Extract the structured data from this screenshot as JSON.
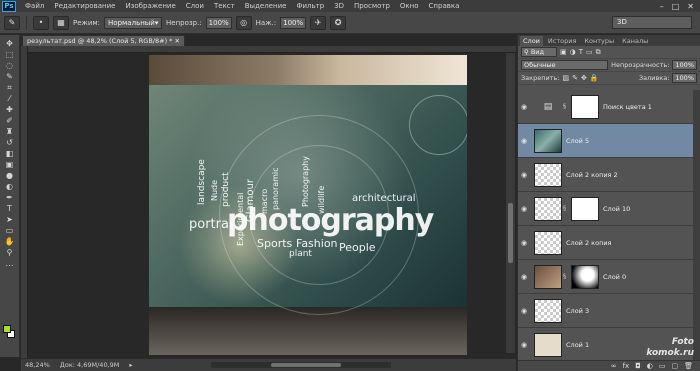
{
  "menubar": {
    "logo": "Ps",
    "items": [
      "Файл",
      "Редактирование",
      "Изображение",
      "Слои",
      "Текст",
      "Выделение",
      "Фильтр",
      "3D",
      "Просмотр",
      "Окно",
      "Справка"
    ]
  },
  "options": {
    "mode_label": "Режим:",
    "mode_value": "Нормальный",
    "opacity_label": "Непрозр.:",
    "opacity_value": "100%",
    "pressure_label": "Наж.:",
    "pressure_value": "100%",
    "workspace": "3D"
  },
  "document": {
    "tab_title": "результат.psd @ 48,2% (Слой 5, RGB/8#) *",
    "zoom": "48,24%",
    "doc_info": "Док: 4,69M/40,9M"
  },
  "image_words": {
    "photography": "photography",
    "portrait": "portrai",
    "landscape": "landscape",
    "nude": "Nude",
    "product": "product",
    "experimental": "Experimental",
    "glamour": "Glamour",
    "macro": "macro",
    "panoramic": "panoramic",
    "photography_small": "Photography",
    "wildlife": "wildlife",
    "architectural": "architectural",
    "sports": "Sports",
    "fashion": "Fashion",
    "people": "People",
    "plant": "plant"
  },
  "layers_panel": {
    "tabs": [
      "Слои",
      "История",
      "Контуры",
      "Каналы"
    ],
    "filter_label": "Вид",
    "blend_mode": "Обычные",
    "opacity_label": "Непрозрачность:",
    "opacity_value": "100%",
    "lock_label": "Закрепить:",
    "fill_label": "Заливка:",
    "fill_value": "100%",
    "layers": [
      {
        "name": "Поиск цвета 1"
      },
      {
        "name": "Слой 5"
      },
      {
        "name": "Слой 2 копия 2"
      },
      {
        "name": "Слой 10"
      },
      {
        "name": "Слой 2 копия"
      },
      {
        "name": "Слой 0"
      },
      {
        "name": "Слой 3"
      },
      {
        "name": "Слой 1"
      }
    ]
  },
  "watermark": {
    "line1": "Foto",
    "line2": "komok.ru"
  },
  "colors": {
    "foreground": "#a8e025",
    "background": "#ffffff",
    "selected_layer": "#7289a4"
  }
}
